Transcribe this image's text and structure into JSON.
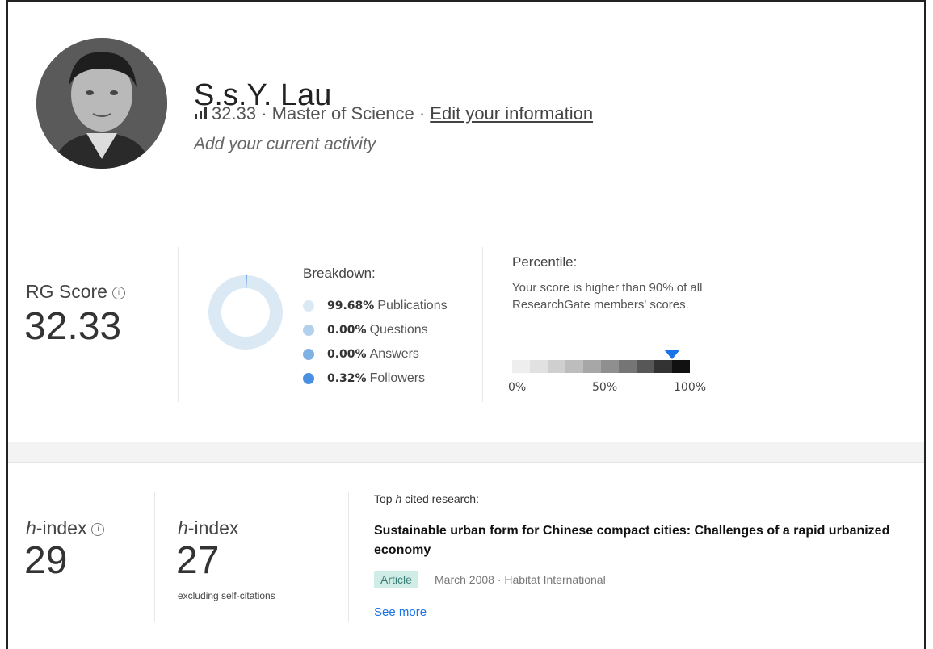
{
  "profile": {
    "name": "S.s.Y. Lau",
    "score": "32.33",
    "sep1": "·",
    "degree": "Master of Science",
    "sep2": "·",
    "edit_link": "Edit your information",
    "activity_placeholder": "Add your current activity"
  },
  "rg_score": {
    "label": "RG Score",
    "value": "32.33"
  },
  "breakdown": {
    "title": "Breakdown:",
    "items": [
      {
        "pct": "99.68%",
        "label": "Publications",
        "color": "#dbe9f5",
        "value": 99.68
      },
      {
        "pct": "0.00%",
        "label": "Questions",
        "color": "#b3d0ec",
        "value": 0.0
      },
      {
        "pct": "0.00%",
        "label": "Answers",
        "color": "#7fb1e2",
        "value": 0.0
      },
      {
        "pct": "0.32%",
        "label": "Followers",
        "color": "#4a90e2",
        "value": 0.32
      }
    ]
  },
  "percentile": {
    "title": "Percentile:",
    "text": "Your score is higher than 90% of all ResearchGate members' scores.",
    "value": 90,
    "axis": [
      "0%",
      "50%",
      "100%"
    ],
    "marker_color": "#1a73e8",
    "steps": [
      "#eeeeee",
      "#e1e1e1",
      "#cfcfcf",
      "#bdbdbd",
      "#a7a7a7",
      "#8f8f8f",
      "#757575",
      "#575757",
      "#333333",
      "#111111"
    ]
  },
  "hindex": {
    "prefix": "h",
    "suffix": "-index",
    "value": "29",
    "excl_prefix": "h",
    "excl_suffix": "-index",
    "excl_value": "27",
    "excl_note": "excluding self-citations"
  },
  "top_cited": {
    "label_pre": "Top ",
    "label_h": "h",
    "label_post": " cited research:",
    "title": "Sustainable urban form for Chinese compact cities: Challenges of a rapid urbanized economy",
    "type_badge": "Article",
    "meta": "March 2008 · Habitat International",
    "see_more": "See more"
  }
}
